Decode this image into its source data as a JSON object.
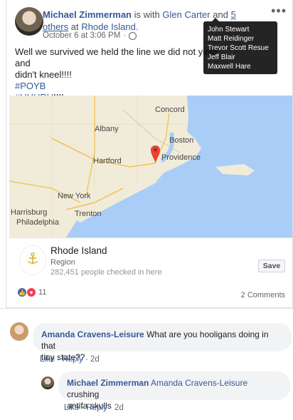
{
  "post": {
    "author": "Michael Zimmerman",
    "with_text": "is with",
    "tagged_person": "Glen Carter",
    "and_text": "and",
    "others_link": "5 others",
    "at_text": "at",
    "location": "Rhode Island.",
    "timestamp": "October 6 at 3:06 PM",
    "visibility_icon": "globe-icon",
    "more_icon": "more-icon",
    "more_label": "•••",
    "tooltip_names": [
      "John Stewart",
      "Matt Reidinger",
      "Trevor Scott Resue",
      "Jeff Blair",
      "Maxwell Hare"
    ],
    "text_line1": "Well we survived we held the line we did not yield and",
    "text_line2": "didn't kneel!!!!",
    "hashtag1": "#POYB",
    "hashtag2": "#UHURU",
    "hashtag2_suffix": "!!!!"
  },
  "map": {
    "labels": [
      "Concord",
      "Albany",
      "Boston",
      "Hartford",
      "Providence",
      "New York",
      "Harrisburg",
      "Trenton",
      "Philadelphia"
    ]
  },
  "place": {
    "name": "Rhode Island",
    "type": "Region",
    "checkins": "282,451 people checked in here",
    "save_label": "Save"
  },
  "engagement": {
    "reaction_count": "11",
    "comments": "2 Comments"
  },
  "comments": [
    {
      "author": "Amanda Cravens-Leisure",
      "text_line1": "What are you hooligans doing in that",
      "text_line2": "tiny state??",
      "like": "Like",
      "reply": "Reply",
      "time": "2d"
    },
    {
      "author": "Michael Zimmerman",
      "mention": "Amanda Cravens-Leisure",
      "text_line1": "crushing",
      "text_line2": "antifa skulls",
      "like": "Like",
      "reply": "Reply",
      "time": "2d"
    }
  ],
  "colors": {
    "link": "#365899",
    "water": "#a9cdf6",
    "land": "#f1ecd9",
    "pin": "#ea4335"
  }
}
